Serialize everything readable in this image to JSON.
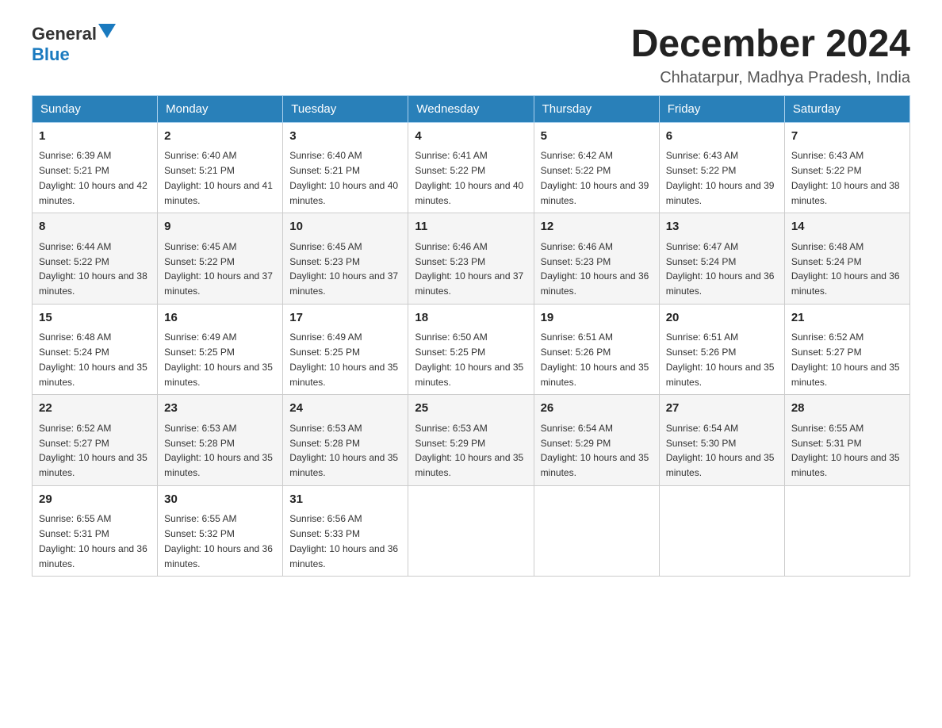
{
  "header": {
    "logo": {
      "text_general": "General",
      "text_blue": "Blue",
      "aria": "GeneralBlue logo"
    },
    "title": "December 2024",
    "location": "Chhatarpur, Madhya Pradesh, India"
  },
  "weekdays": [
    "Sunday",
    "Monday",
    "Tuesday",
    "Wednesday",
    "Thursday",
    "Friday",
    "Saturday"
  ],
  "weeks": [
    [
      {
        "day": "1",
        "sunrise": "6:39 AM",
        "sunset": "5:21 PM",
        "daylight": "10 hours and 42 minutes."
      },
      {
        "day": "2",
        "sunrise": "6:40 AM",
        "sunset": "5:21 PM",
        "daylight": "10 hours and 41 minutes."
      },
      {
        "day": "3",
        "sunrise": "6:40 AM",
        "sunset": "5:21 PM",
        "daylight": "10 hours and 40 minutes."
      },
      {
        "day": "4",
        "sunrise": "6:41 AM",
        "sunset": "5:22 PM",
        "daylight": "10 hours and 40 minutes."
      },
      {
        "day": "5",
        "sunrise": "6:42 AM",
        "sunset": "5:22 PM",
        "daylight": "10 hours and 39 minutes."
      },
      {
        "day": "6",
        "sunrise": "6:43 AM",
        "sunset": "5:22 PM",
        "daylight": "10 hours and 39 minutes."
      },
      {
        "day": "7",
        "sunrise": "6:43 AM",
        "sunset": "5:22 PM",
        "daylight": "10 hours and 38 minutes."
      }
    ],
    [
      {
        "day": "8",
        "sunrise": "6:44 AM",
        "sunset": "5:22 PM",
        "daylight": "10 hours and 38 minutes."
      },
      {
        "day": "9",
        "sunrise": "6:45 AM",
        "sunset": "5:22 PM",
        "daylight": "10 hours and 37 minutes."
      },
      {
        "day": "10",
        "sunrise": "6:45 AM",
        "sunset": "5:23 PM",
        "daylight": "10 hours and 37 minutes."
      },
      {
        "day": "11",
        "sunrise": "6:46 AM",
        "sunset": "5:23 PM",
        "daylight": "10 hours and 37 minutes."
      },
      {
        "day": "12",
        "sunrise": "6:46 AM",
        "sunset": "5:23 PM",
        "daylight": "10 hours and 36 minutes."
      },
      {
        "day": "13",
        "sunrise": "6:47 AM",
        "sunset": "5:24 PM",
        "daylight": "10 hours and 36 minutes."
      },
      {
        "day": "14",
        "sunrise": "6:48 AM",
        "sunset": "5:24 PM",
        "daylight": "10 hours and 36 minutes."
      }
    ],
    [
      {
        "day": "15",
        "sunrise": "6:48 AM",
        "sunset": "5:24 PM",
        "daylight": "10 hours and 35 minutes."
      },
      {
        "day": "16",
        "sunrise": "6:49 AM",
        "sunset": "5:25 PM",
        "daylight": "10 hours and 35 minutes."
      },
      {
        "day": "17",
        "sunrise": "6:49 AM",
        "sunset": "5:25 PM",
        "daylight": "10 hours and 35 minutes."
      },
      {
        "day": "18",
        "sunrise": "6:50 AM",
        "sunset": "5:25 PM",
        "daylight": "10 hours and 35 minutes."
      },
      {
        "day": "19",
        "sunrise": "6:51 AM",
        "sunset": "5:26 PM",
        "daylight": "10 hours and 35 minutes."
      },
      {
        "day": "20",
        "sunrise": "6:51 AM",
        "sunset": "5:26 PM",
        "daylight": "10 hours and 35 minutes."
      },
      {
        "day": "21",
        "sunrise": "6:52 AM",
        "sunset": "5:27 PM",
        "daylight": "10 hours and 35 minutes."
      }
    ],
    [
      {
        "day": "22",
        "sunrise": "6:52 AM",
        "sunset": "5:27 PM",
        "daylight": "10 hours and 35 minutes."
      },
      {
        "day": "23",
        "sunrise": "6:53 AM",
        "sunset": "5:28 PM",
        "daylight": "10 hours and 35 minutes."
      },
      {
        "day": "24",
        "sunrise": "6:53 AM",
        "sunset": "5:28 PM",
        "daylight": "10 hours and 35 minutes."
      },
      {
        "day": "25",
        "sunrise": "6:53 AM",
        "sunset": "5:29 PM",
        "daylight": "10 hours and 35 minutes."
      },
      {
        "day": "26",
        "sunrise": "6:54 AM",
        "sunset": "5:29 PM",
        "daylight": "10 hours and 35 minutes."
      },
      {
        "day": "27",
        "sunrise": "6:54 AM",
        "sunset": "5:30 PM",
        "daylight": "10 hours and 35 minutes."
      },
      {
        "day": "28",
        "sunrise": "6:55 AM",
        "sunset": "5:31 PM",
        "daylight": "10 hours and 35 minutes."
      }
    ],
    [
      {
        "day": "29",
        "sunrise": "6:55 AM",
        "sunset": "5:31 PM",
        "daylight": "10 hours and 36 minutes."
      },
      {
        "day": "30",
        "sunrise": "6:55 AM",
        "sunset": "5:32 PM",
        "daylight": "10 hours and 36 minutes."
      },
      {
        "day": "31",
        "sunrise": "6:56 AM",
        "sunset": "5:33 PM",
        "daylight": "10 hours and 36 minutes."
      },
      null,
      null,
      null,
      null
    ]
  ]
}
